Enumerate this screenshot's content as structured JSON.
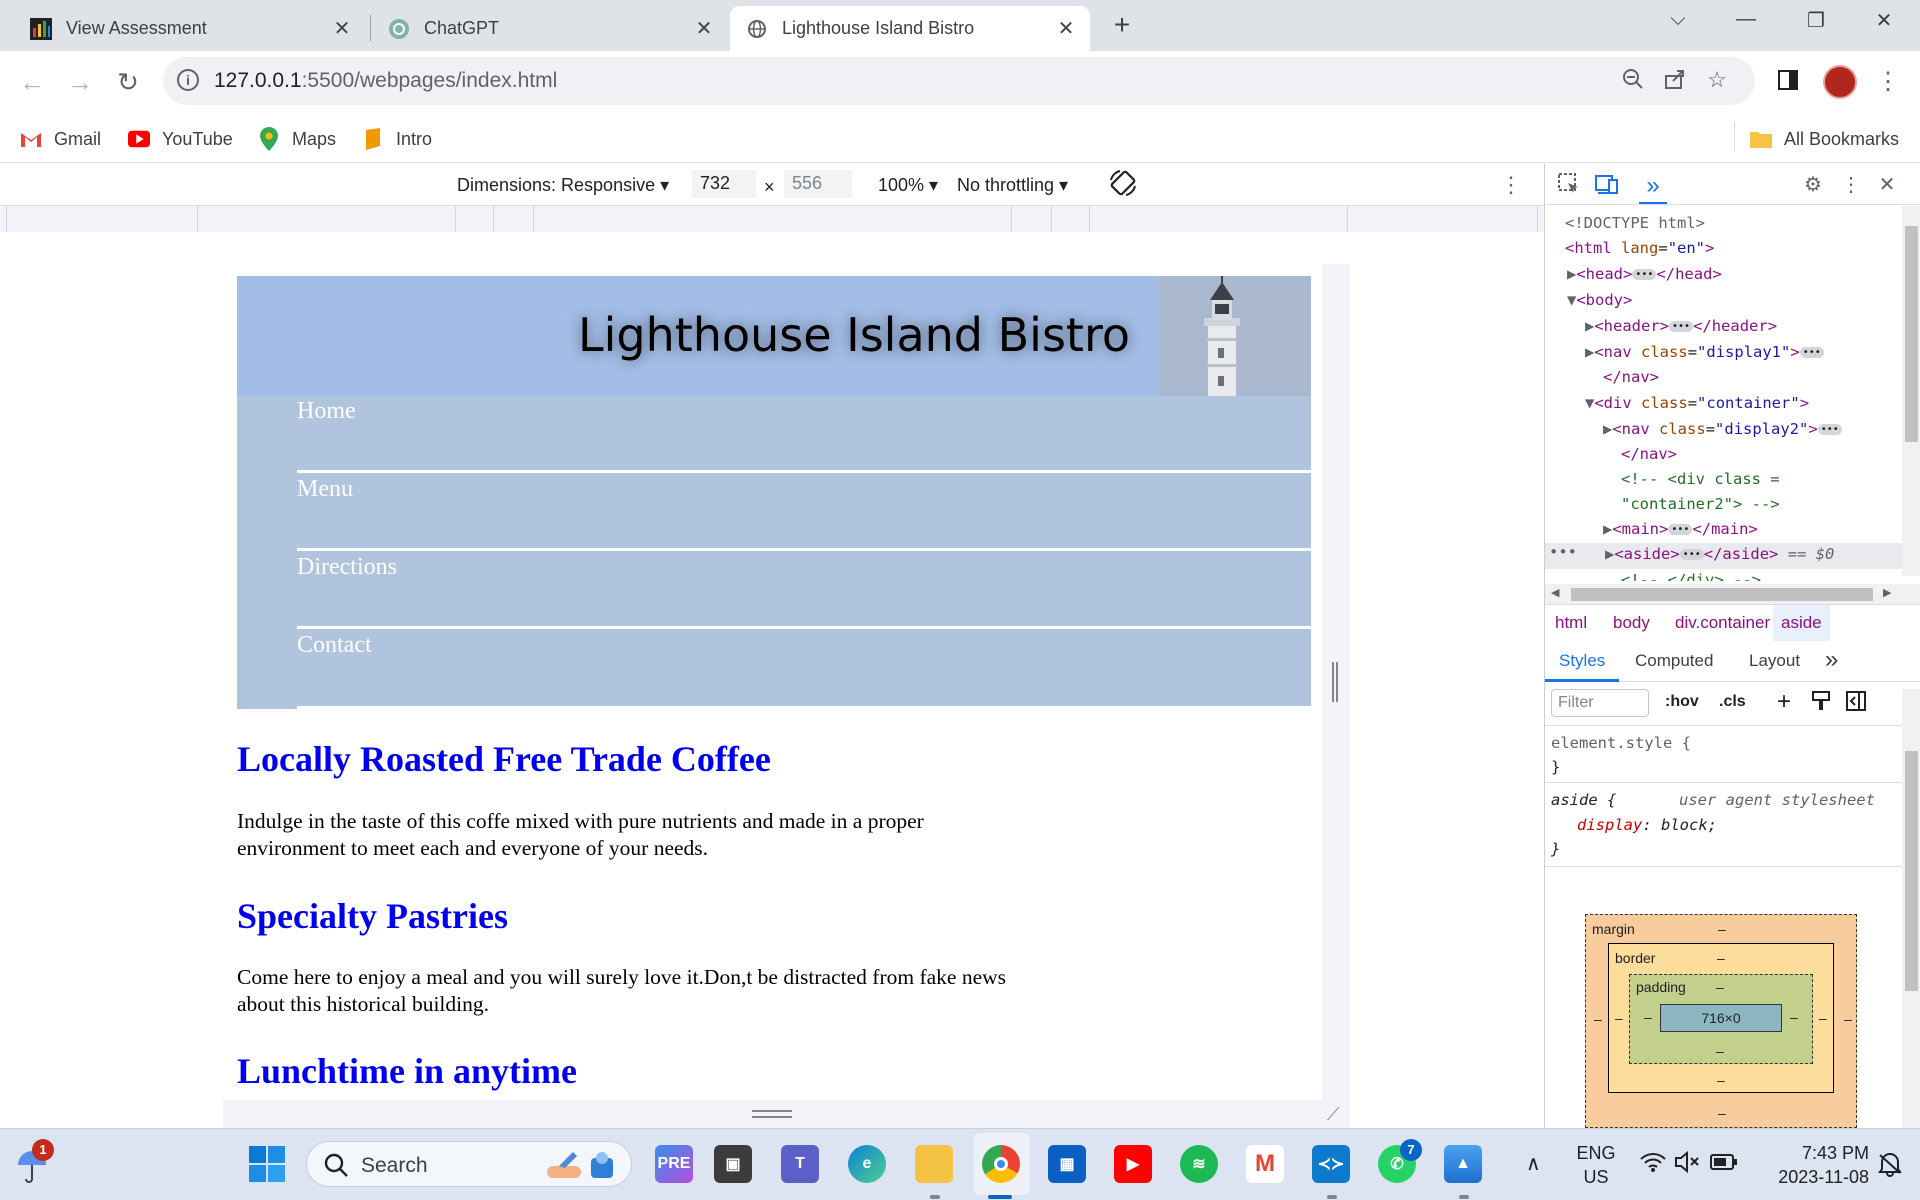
{
  "browser": {
    "tabs": [
      {
        "title": "View Assessment",
        "icon": "chart-bars-icon"
      },
      {
        "title": "ChatGPT",
        "icon": "openai-icon"
      },
      {
        "title": "Lighthouse Island Bistro",
        "icon": "globe-icon",
        "active": true
      }
    ],
    "new_tab": "+",
    "window_controls": {
      "dropdown": "⌵",
      "minimize": "—",
      "restore": "❐",
      "close": "✕"
    },
    "url": "127.0.0.1:5500/webpages/index.html",
    "url_host": "127.0.0.1",
    "url_rest": ":5500/webpages/index.html"
  },
  "bookmarks": {
    "items": [
      {
        "label": "Gmail",
        "icon": "gmail-icon"
      },
      {
        "label": "YouTube",
        "icon": "youtube-icon"
      },
      {
        "label": "Maps",
        "icon": "maps-icon"
      },
      {
        "label": "Intro",
        "icon": "intro-icon"
      }
    ],
    "all_bookmarks": "All Bookmarks"
  },
  "device_toolbar": {
    "dimensions": "Dimensions: Responsive ▾",
    "width": "732",
    "times": "×",
    "height": "556",
    "zoom": "100% ▾",
    "throttling": "No throttling ▾"
  },
  "site": {
    "title": "Lighthouse Island Bistro",
    "nav": [
      "Home",
      "Menu",
      "Directions",
      "Contact"
    ],
    "sections": [
      {
        "heading": "Locally Roasted Free Trade Coffee",
        "text": "Indulge in the taste of this coffe mixed with pure nutrients and made in a proper environment to meet each and everyone of your needs."
      },
      {
        "heading": "Specialty Pastries",
        "text": "Come here to enjoy a meal and you will surely love it.Don,t be distracted from fake news about this historical building."
      },
      {
        "heading": "Lunchtime in anytime",
        "text": ""
      }
    ]
  },
  "devtools": {
    "breadcrumbs": [
      "html",
      "body",
      "div.container",
      "aside"
    ],
    "subtabs": [
      "Styles",
      "Computed",
      "Layout",
      "»"
    ],
    "filter_placeholder": "Filter",
    "hov": ":hov",
    "cls": ".cls",
    "dom": {
      "doctype": "<!DOCTYPE html>",
      "html_open": "<html",
      "html_lang_attr": "lang",
      "html_lang_val": "\"en\"",
      "head": "<head>",
      "head_close": "</head>",
      "body": "<body>",
      "header": "<header>",
      "header_close": "</header>",
      "nav": "<nav",
      "nav_close": "</nav>",
      "class_attr": "class",
      "display1": "\"display1\"",
      "div": "<div",
      "container": "\"container\"",
      "display2": "\"display2\"",
      "comment1": "<!-- <div class =",
      "comment2": "\"container2\"> -->",
      "main": "<main>",
      "main_close": "</main>",
      "aside": "<aside>",
      "aside_close": "</aside>",
      "selected_marker": "== $0",
      "cut_line": "<!-- </div> -->"
    },
    "styles": {
      "element_style": "element.style {",
      "close_brace": "}",
      "aside_selector": "aside {",
      "ua_label": "user agent stylesheet",
      "prop": "display",
      "value": "block;"
    },
    "box_model": {
      "margin": "margin",
      "border": "border",
      "padding": "padding",
      "content": "716×0",
      "dash": "–"
    }
  },
  "taskbar": {
    "search_placeholder": "Search",
    "weather_badge": "1",
    "whatsapp_badge": "7",
    "lang_top": "ENG",
    "lang_bottom": "US",
    "time": "7:43 PM",
    "date": "2023-11-08"
  }
}
